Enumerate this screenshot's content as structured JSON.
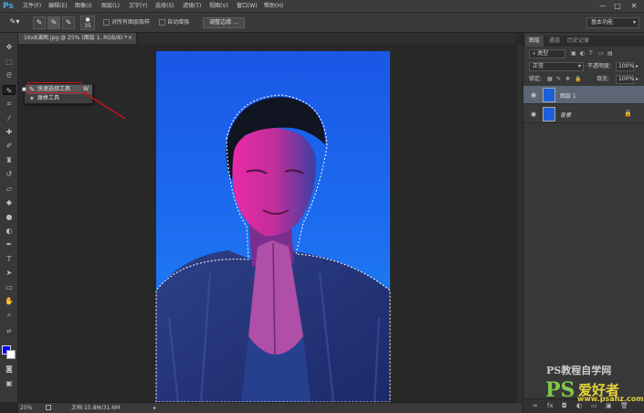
{
  "app": {
    "logo": "Ps"
  },
  "menu": [
    "文件(F)",
    "编辑(E)",
    "图像(I)",
    "图层(L)",
    "文字(Y)",
    "选择(S)",
    "滤镜(T)",
    "视图(V)",
    "窗口(W)",
    "帮助(H)"
  ],
  "window_controls": {
    "minimize": "—",
    "maximize": "□",
    "close": "✕"
  },
  "options_bar": {
    "brush_size": "35",
    "sample_all_layers_label": "对所有图层取样",
    "auto_enhance_label": "自动增强",
    "refine_edge_label": "调整边缘 ...",
    "workspace_label": "基本功能"
  },
  "document": {
    "tab_title": "16x8演图.jpg @ 25% (图层 1, RGB/8) *",
    "tab_close": "×",
    "zoom": "25%",
    "doc_size": "文档:15.8M/31.6M"
  },
  "tool_flyout": {
    "items": [
      {
        "label": "快速选择工具",
        "shortcut": "W",
        "icon": "quick-selection-icon",
        "active": true
      },
      {
        "label": "魔棒工具",
        "shortcut": "",
        "icon": "magic-wand-icon",
        "active": false
      }
    ]
  },
  "annotation_color": "#c0141c",
  "foreground_color": "#0000ff",
  "background_color": "#ffffff",
  "panels": {
    "tabs": [
      "图层",
      "通道",
      "历史记录"
    ],
    "kind_filter": "类型",
    "blend_mode": "正常",
    "opacity_label": "不透明度:",
    "opacity_value": "100%",
    "lock_label": "锁定:",
    "fill_label": "填充:",
    "fill_value": "100%",
    "layers": [
      {
        "name": "图层 1",
        "selected": true
      },
      {
        "name": "背景",
        "selected": false,
        "locked": true
      }
    ]
  },
  "watermark": {
    "text": "PS教程自学网",
    "logo_text": "PS爱好者",
    "url": "www.psahz.com"
  }
}
